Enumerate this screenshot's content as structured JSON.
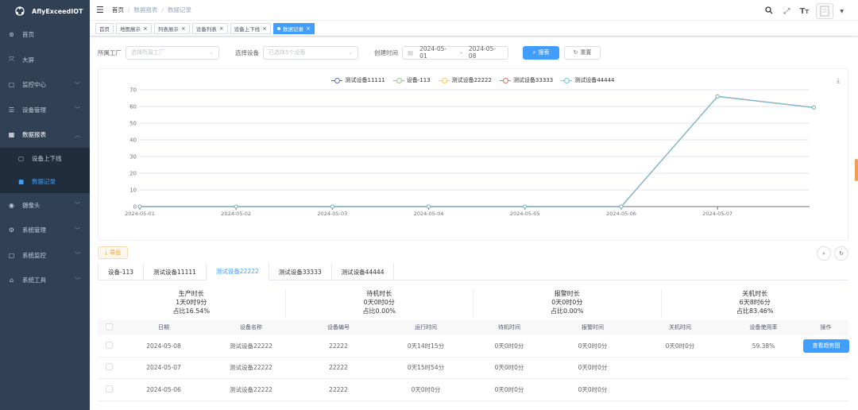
{
  "sidebar": {
    "logo_text": "AflyExceedIOT",
    "items": [
      {
        "icon": "dashboard-icon",
        "glyph": "⊛",
        "label": "首页",
        "chevron": false
      },
      {
        "icon": "fullscreen-icon",
        "glyph": "⤧",
        "label": "大屏",
        "chevron": false
      },
      {
        "icon": "monitor-icon",
        "glyph": "▢",
        "label": "监控中心",
        "chevron": true
      },
      {
        "icon": "list-icon",
        "glyph": "☰",
        "label": "设备管理",
        "chevron": true
      },
      {
        "icon": "table-icon",
        "glyph": "▦",
        "label": "数据报表",
        "chevron": true,
        "open": true
      }
    ],
    "sub_items": [
      {
        "icon": "device-icon",
        "glyph": "▢",
        "label": "设备上下线",
        "active": false
      },
      {
        "icon": "record-icon",
        "glyph": "■",
        "label": "数据记录",
        "active": true
      }
    ],
    "items_after": [
      {
        "icon": "camera-icon",
        "glyph": "◉",
        "label": "摄像头",
        "chevron": true
      },
      {
        "icon": "gear-icon",
        "glyph": "⚙",
        "label": "系统管理",
        "chevron": true
      },
      {
        "icon": "monitor-icon",
        "glyph": "▢",
        "label": "系统监控",
        "chevron": true
      },
      {
        "icon": "tools-icon",
        "glyph": "⌂",
        "label": "系统工具",
        "chevron": true
      }
    ]
  },
  "breadcrumb": {
    "home": "首页",
    "section": "数据报表",
    "current": "数据记录"
  },
  "tags": [
    {
      "label": "首页",
      "closable": false,
      "active": false
    },
    {
      "label": "地图展示",
      "closable": true,
      "active": false
    },
    {
      "label": "列表展示",
      "closable": true,
      "active": false
    },
    {
      "label": "设备列表",
      "closable": true,
      "active": false
    },
    {
      "label": "设备上下线",
      "closable": true,
      "active": false
    },
    {
      "label": "数据记录",
      "closable": true,
      "active": true
    }
  ],
  "filters": {
    "factory_label": "所属工厂",
    "factory_placeholder": "选择所属工厂",
    "device_label": "选择设备",
    "device_placeholder": "已选择5个设备",
    "created_label": "创建时间",
    "date_start": "2024-05-01",
    "date_sep": "-",
    "date_end": "2024-05-08",
    "search_label": "搜索",
    "reset_label": "重置"
  },
  "chart_data": {
    "type": "line",
    "categories": [
      "2024-05-01",
      "2024-05-02",
      "2024-05-03",
      "2024-05-04",
      "2024-05-05",
      "2024-05-06",
      "2024-05-07",
      "2024-05-08"
    ],
    "x_tick_labels": [
      "2024-05-01",
      "2024-05-02",
      "2024-05-03",
      "2024-05-04",
      "2024-05-05",
      "2024-05-06",
      "2024-05-07"
    ],
    "ylim": [
      0,
      70
    ],
    "yticks": [
      0,
      10,
      20,
      30,
      40,
      50,
      60,
      70
    ],
    "legend_position": "top",
    "series": [
      {
        "name": "测试设备11111",
        "color": "#5470c6",
        "values": [
          0,
          0,
          0,
          0,
          0,
          0,
          66,
          59.38
        ]
      },
      {
        "name": "设备-113",
        "color": "#91cc75",
        "values": [
          0,
          0,
          0,
          0,
          0,
          0,
          66,
          59.38
        ]
      },
      {
        "name": "测试设备22222",
        "color": "#fac858",
        "values": [
          0,
          0,
          0,
          0,
          0,
          0,
          66,
          59.38
        ]
      },
      {
        "name": "测试设备33333",
        "color": "#ee6666",
        "values": [
          0,
          0,
          0,
          0,
          0,
          0,
          66,
          59.38
        ]
      },
      {
        "name": "测试设备44444",
        "color": "#73c0de",
        "values": [
          0,
          0,
          0,
          0,
          0,
          0,
          66,
          59.38
        ]
      }
    ]
  },
  "export_label": "导出",
  "tabs": [
    {
      "label": "设备-113",
      "active": false
    },
    {
      "label": "测试设备11111",
      "active": false
    },
    {
      "label": "测试设备22222",
      "active": true
    },
    {
      "label": "测试设备33333",
      "active": false
    },
    {
      "label": "测试设备44444",
      "active": false
    }
  ],
  "summary": [
    {
      "title": "生产时长",
      "value": "1天0时9分",
      "ratio": "占比16.54%"
    },
    {
      "title": "待机时长",
      "value": "0天0时0分",
      "ratio": "占比0.00%"
    },
    {
      "title": "报警时长",
      "value": "0天0时0分",
      "ratio": "占比0.00%"
    },
    {
      "title": "关机时长",
      "value": "6天8时6分",
      "ratio": "占比83.46%"
    }
  ],
  "table": {
    "headers": [
      "日期",
      "设备名称",
      "设备编号",
      "运行时间",
      "待机时间",
      "报警时间",
      "关机时间",
      "设备使用率",
      "操作"
    ],
    "rows": [
      {
        "date": "2024-05-08",
        "name": "测试设备22222",
        "code": "22222",
        "run": "0天14时15分",
        "standby": "0天0时0分",
        "alarm": "0天0时0分",
        "off": "0天0时0分",
        "usage": "59.38%",
        "action": "查看趋势图"
      },
      {
        "date": "2024-05-07",
        "name": "测试设备22222",
        "code": "22222",
        "run": "0天15时54分",
        "standby": "0天0时0分",
        "alarm": "0天0时0分",
        "off": "",
        "usage": "",
        "action": ""
      },
      {
        "date": "2024-05-06",
        "name": "测试设备22222",
        "code": "22222",
        "run": "0天0时0分",
        "standby": "0天0时0分",
        "alarm": "0天0时0分",
        "off": "",
        "usage": "",
        "action": ""
      }
    ]
  }
}
